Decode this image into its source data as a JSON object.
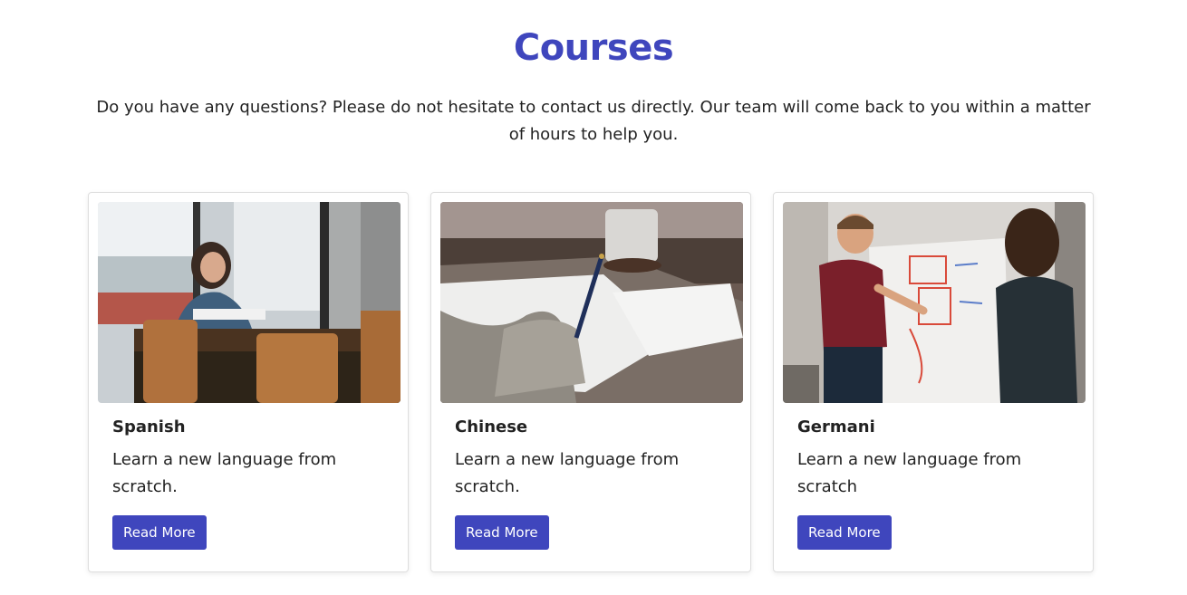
{
  "section": {
    "title": "Courses",
    "subtitle": "Do you have any questions? Please do not hesitate to contact us directly. Our team will come back to you within a matter of hours to help you."
  },
  "colors": {
    "accent": "#3f46bd",
    "text": "#222222",
    "button_text": "#ffffff"
  },
  "cards": [
    {
      "title": "Spanish",
      "text": "Learn a new language from scratch.",
      "button_label": "Read More",
      "image": "student-studying-photo"
    },
    {
      "title": "Chinese",
      "text": "Learn a new language from scratch.",
      "button_label": "Read More",
      "image": "writing-notes-photo"
    },
    {
      "title": "Germani",
      "text": "Learn a new language from scratch",
      "button_label": "Read More",
      "image": "whiteboard-discussion-photo"
    }
  ]
}
